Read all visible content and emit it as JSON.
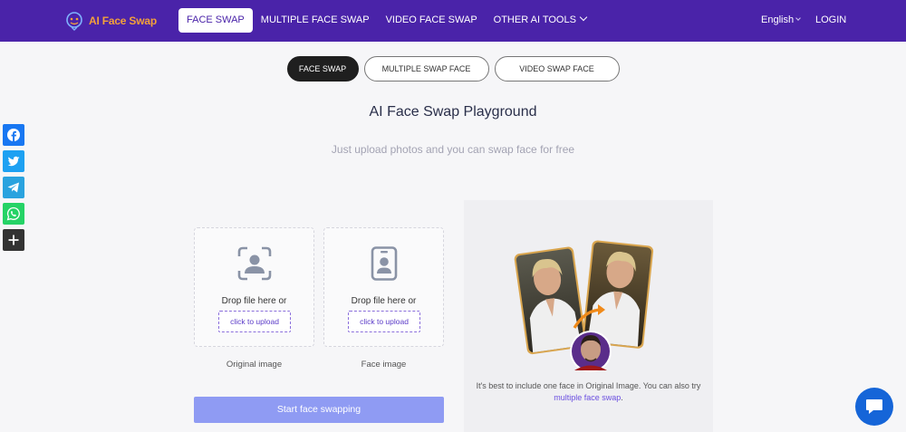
{
  "header": {
    "logo_text": "AI Face Swap",
    "nav": [
      {
        "label": "FACE SWAP",
        "active": true
      },
      {
        "label": "MULTIPLE FACE SWAP",
        "active": false
      },
      {
        "label": "VIDEO FACE SWAP",
        "active": false
      },
      {
        "label": "OTHER AI TOOLS",
        "active": false,
        "dropdown": true
      }
    ],
    "language": "English",
    "login": "LOGIN",
    "bg_color": "#4a23a9"
  },
  "tabs": [
    {
      "label": "FACE SWAP",
      "active": true
    },
    {
      "label": "MULTIPLE SWAP FACE",
      "active": false
    },
    {
      "label": "VIDEO SWAP FACE",
      "active": false
    }
  ],
  "title": "AI Face Swap Playground",
  "subtitle": "Just upload photos and you can swap face for free",
  "share": [
    {
      "icon": "facebook-icon",
      "color": "#1877f2"
    },
    {
      "icon": "twitter-icon",
      "color": "#1da1f2"
    },
    {
      "icon": "telegram-icon",
      "color": "#2aa3df"
    },
    {
      "icon": "whatsapp-icon",
      "color": "#25d366"
    },
    {
      "icon": "plus-icon",
      "color": "#333333"
    }
  ],
  "uploads": {
    "original": {
      "drop_text": "Drop file here or",
      "button": "click to upload",
      "caption": "Original image"
    },
    "face": {
      "drop_text": "Drop file here or",
      "button": "click to upload",
      "caption": "Face image"
    }
  },
  "start_button": "Start face swapping",
  "preview": {
    "note_prefix": "It's best to include one face in Original Image. You can also try ",
    "note_link": "multiple face swap",
    "note_suffix": "."
  }
}
